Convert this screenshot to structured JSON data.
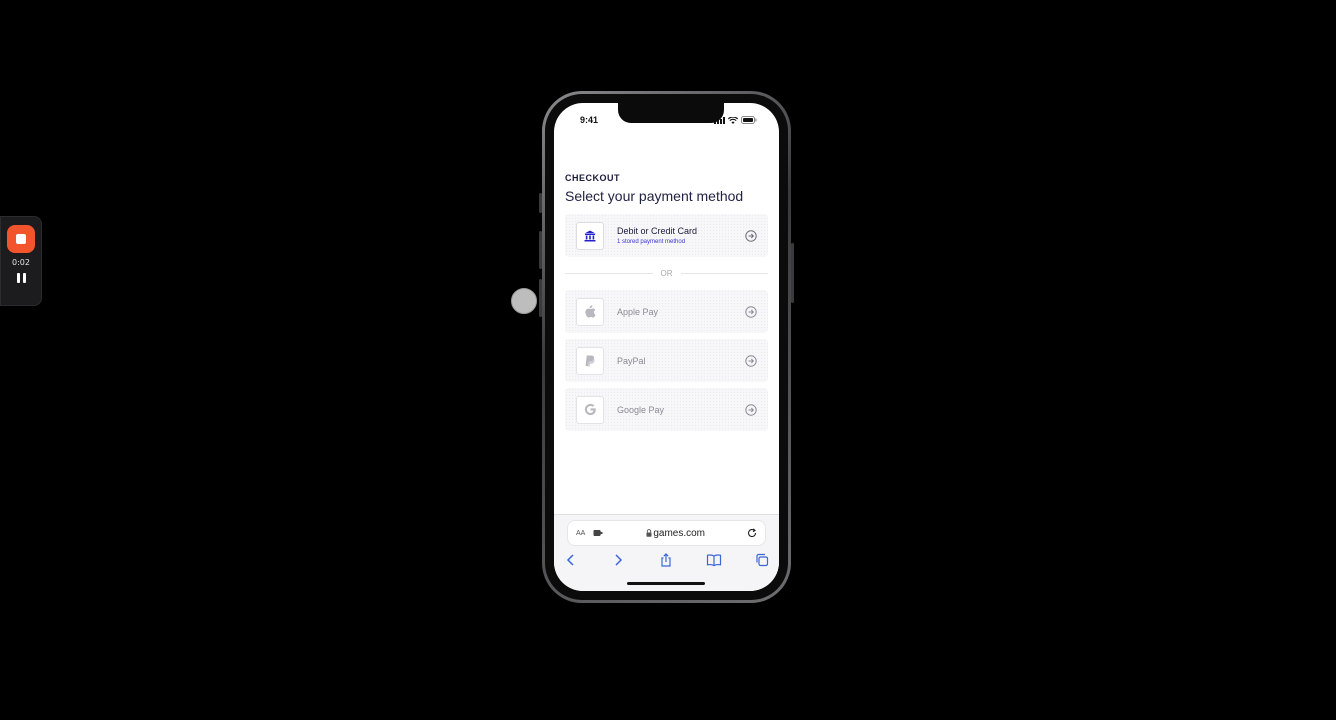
{
  "recorder": {
    "elapsed": "0:02"
  },
  "status_bar": {
    "time": "9:41"
  },
  "checkout": {
    "eyebrow": "CHECKOUT",
    "heading": "Select your payment method",
    "primary_method": {
      "label": "Debit or Credit Card",
      "sub": "1 stored payment method",
      "icon": "bank-icon"
    },
    "divider_text": "OR",
    "alt_methods": [
      {
        "label": "Apple Pay",
        "icon": "apple-icon"
      },
      {
        "label": "PayPal",
        "icon": "paypal-icon"
      },
      {
        "label": "Google Pay",
        "icon": "google-icon"
      }
    ]
  },
  "browser": {
    "aa_label": "AA",
    "url": "games.com"
  },
  "colors": {
    "accent": "#3a35d0",
    "heading": "#222244",
    "record": "#f2552c"
  }
}
